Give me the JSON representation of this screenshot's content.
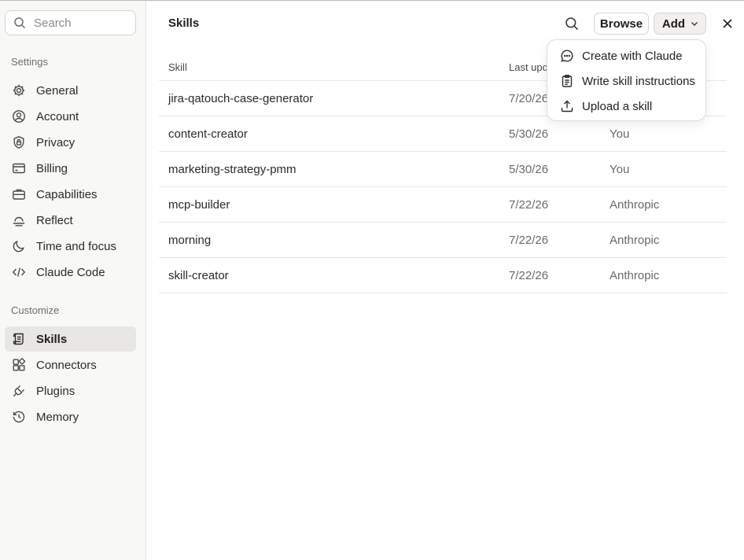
{
  "sidebar": {
    "search_placeholder": "Search",
    "settings_label": "Settings",
    "settings_items": [
      {
        "label": "General",
        "icon": "gear-icon"
      },
      {
        "label": "Account",
        "icon": "user-circle-icon"
      },
      {
        "label": "Privacy",
        "icon": "shield-lock-icon"
      },
      {
        "label": "Billing",
        "icon": "credit-card-icon"
      },
      {
        "label": "Capabilities",
        "icon": "briefcase-icon"
      },
      {
        "label": "Reflect",
        "icon": "sunset-icon"
      },
      {
        "label": "Time and focus",
        "icon": "moon-icon"
      },
      {
        "label": "Claude Code",
        "icon": "code-icon"
      }
    ],
    "customize_label": "Customize",
    "customize_items": [
      {
        "label": "Skills",
        "icon": "scroll-icon",
        "active": true
      },
      {
        "label": "Connectors",
        "icon": "blocks-icon"
      },
      {
        "label": "Plugins",
        "icon": "plug-icon"
      },
      {
        "label": "Memory",
        "icon": "history-icon"
      }
    ]
  },
  "main": {
    "title": "Skills",
    "browse_label": "Browse",
    "add_label": "Add",
    "columns": {
      "skill": "Skill",
      "last_updated": "Last upd"
    },
    "rows": [
      {
        "skill": "jira-qatouch-case-generator",
        "date": "7/20/26",
        "by": ""
      },
      {
        "skill": "content-creator",
        "date": "5/30/26",
        "by": "You"
      },
      {
        "skill": "marketing-strategy-pmm",
        "date": "5/30/26",
        "by": "You"
      },
      {
        "skill": "mcp-builder",
        "date": "7/22/26",
        "by": "Anthropic"
      },
      {
        "skill": "morning",
        "date": "7/22/26",
        "by": "Anthropic"
      },
      {
        "skill": "skill-creator",
        "date": "7/22/26",
        "by": "Anthropic"
      }
    ]
  },
  "dropdown": {
    "items": [
      {
        "label": "Create with Claude",
        "icon": "chat-bubble-icon"
      },
      {
        "label": "Write skill instructions",
        "icon": "clipboard-icon"
      },
      {
        "label": "Upload a skill",
        "icon": "upload-icon"
      }
    ]
  },
  "colors": {
    "active_bg": "#e8e7e3",
    "sidebar_bg": "#f8f8f6",
    "text": "#1f1e1d"
  }
}
